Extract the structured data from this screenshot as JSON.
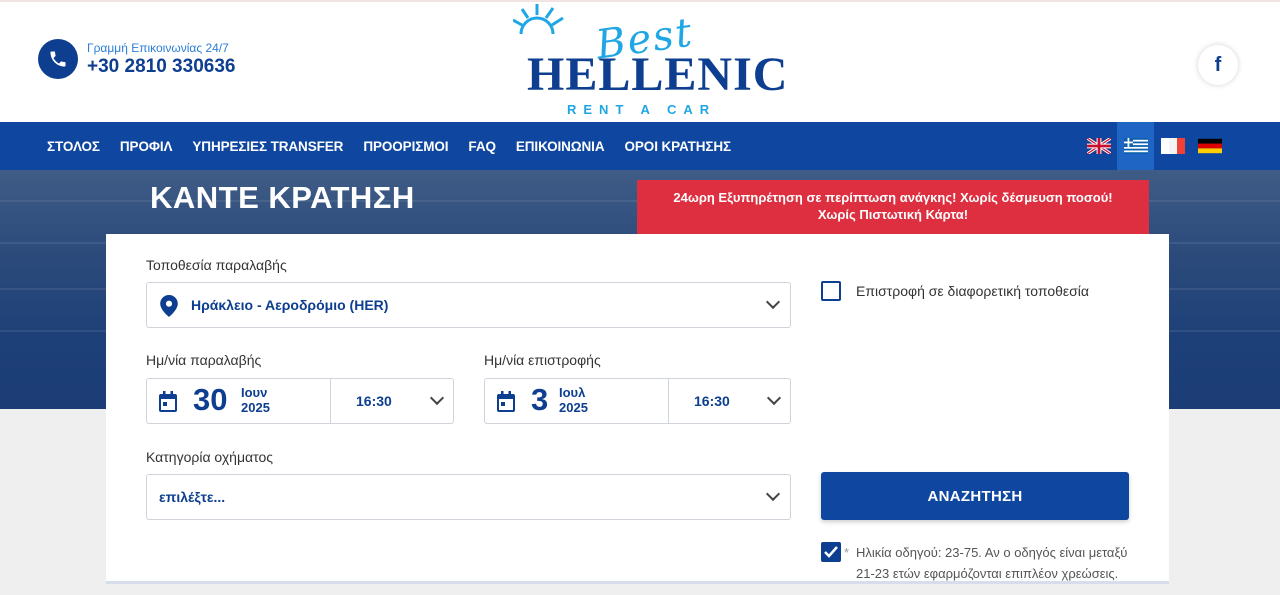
{
  "header": {
    "phone_label": "Γραμμή Επικοινωνίας 24/7",
    "phone_number": "+30 2810 330636",
    "logo": {
      "best": "Best",
      "name": "HELLENIC",
      "sub": "RENT A CAR"
    },
    "facebook_glyph": "f"
  },
  "nav": {
    "items": [
      "ΣΤΟΛΟΣ",
      "ΠΡΟΦΙΛ",
      "ΥΠΗΡΕΣΙΕΣ TRANSFER",
      "ΠΡΟΟΡΙΣΜΟΙ",
      "FAQ",
      "ΕΠΙΚΟΙΝΩΝΙΑ",
      "ΟΡΟΙ ΚΡΑΤΗΣΗΣ"
    ],
    "languages": [
      {
        "code": "en",
        "icon": "uk-flag-icon"
      },
      {
        "code": "el",
        "icon": "greek-flag-icon",
        "active": true
      },
      {
        "code": "fr",
        "icon": "french-flag-icon"
      },
      {
        "code": "de",
        "icon": "german-flag-icon"
      }
    ]
  },
  "hero": {
    "title": "ΚΑΝΤΕ ΚΡΑΤΗΣΗ",
    "notice_line1": "24ωρη Εξυπηρέτηση σε περίπτωση ανάγκης! Χωρίς δέσμευση ποσού!",
    "notice_line2": "Χωρίς Πιστωτική Κάρτα!"
  },
  "form": {
    "pickup_location_label": "Τοποθεσία παραλαβής",
    "pickup_location_value": "Ηράκλειο - Αεροδρόμιο (HER)",
    "different_return_label": "Επιστροφή σε διαφορετική τοποθεσία",
    "different_return_checked": false,
    "pickup_date_label": "Ημ/νία παραλαβής",
    "pickup_day": "30",
    "pickup_month": "Ιουν",
    "pickup_year": "2025",
    "pickup_time": "16:30",
    "return_date_label": "Ημ/νία επιστροφής",
    "return_day": "3",
    "return_month": "Ιουλ",
    "return_year": "2025",
    "return_time": "16:30",
    "category_label": "Κατηγορία οχήματος",
    "category_placeholder": "επιλέξτε...",
    "search_button": "ΑΝΑΖΗΤΗΣΗ",
    "age_checked": true,
    "age_asterisk": "*",
    "age_note_line1": "Ηλικία οδηγού: 23-75. Αν ο οδηγός είναι μεταξύ",
    "age_note_line2": "21-23 ετών εφαρμόζονται επιπλέον χρεώσεις."
  },
  "colors": {
    "brand_blue": "#0f47a0",
    "dark_blue": "#0d3e8f",
    "light_blue": "#1fa6e4",
    "notice_red": "#dd2f3f"
  }
}
